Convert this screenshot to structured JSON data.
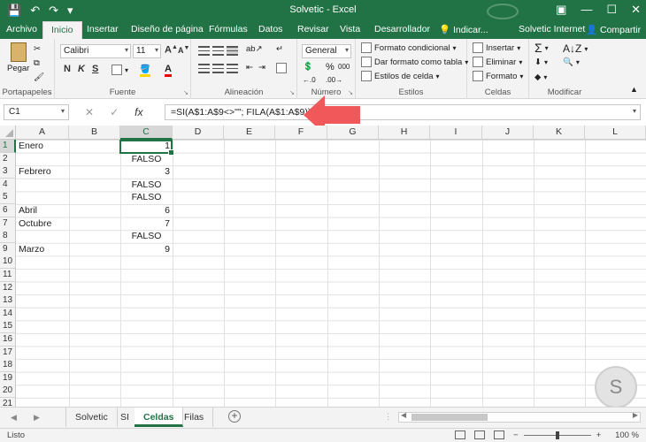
{
  "window": {
    "title": "Solvetic - Excel",
    "user": "Solvetic Internet",
    "share_label": "Compartir",
    "search_hint": "Indicar...",
    "quick_access": [
      "save-icon",
      "undo-icon",
      "redo-icon",
      "customize-icon"
    ]
  },
  "tabs": [
    "Archivo",
    "Inicio",
    "Insertar",
    "Diseño de página",
    "Fórmulas",
    "Datos",
    "Revisar",
    "Vista",
    "Desarrollador"
  ],
  "active_tab": "Inicio",
  "ribbon": {
    "clipboard": {
      "label": "Portapapeles",
      "paste": "Pegar"
    },
    "font": {
      "label": "Fuente",
      "name": "Calibri",
      "size": "11",
      "bold": "N",
      "italic": "K",
      "underline": "S"
    },
    "alignment": {
      "label": "Alineación"
    },
    "number": {
      "label": "Número",
      "format": "General",
      "percent": "%",
      "thousands": "000"
    },
    "styles": {
      "label": "Estilos",
      "conditional": "Formato condicional",
      "table": "Dar formato como tabla",
      "cell_styles": "Estilos de celda"
    },
    "cells": {
      "label": "Celdas",
      "insert": "Insertar",
      "delete": "Eliminar",
      "format": "Formato"
    },
    "editing": {
      "label": "Modificar"
    }
  },
  "formula_bar": {
    "name_box": "C1",
    "formula": "=SI(A$1:A$9<>\"\"; FILA(A$1:A$9))",
    "cancel": "✕",
    "enter": "✓",
    "fx": "fx"
  },
  "grid": {
    "columns": [
      "A",
      "B",
      "C",
      "D",
      "E",
      "F",
      "G",
      "H",
      "I",
      "J",
      "K",
      "L"
    ],
    "rows": [
      "1",
      "2",
      "3",
      "4",
      "5",
      "6",
      "7",
      "8",
      "9",
      "10",
      "11",
      "12",
      "13",
      "14",
      "15",
      "16",
      "17",
      "18",
      "19",
      "20",
      "21"
    ],
    "selected_cell": "C1",
    "col_a": [
      "Enero",
      "",
      "Febrero",
      "",
      "",
      "Abril",
      "Octubre",
      "",
      "Marzo"
    ],
    "col_c": [
      "1",
      "FALSO",
      "3",
      "FALSO",
      "FALSO",
      "6",
      "7",
      "FALSO",
      "9"
    ]
  },
  "sheets": [
    "Solvetic",
    "SI",
    "Celdas",
    "Filas"
  ],
  "active_sheet": "Celdas",
  "status": {
    "text": "Listo",
    "zoom": "100 %"
  },
  "colors": {
    "brand": "#217346",
    "arrow": "#f0585a"
  }
}
